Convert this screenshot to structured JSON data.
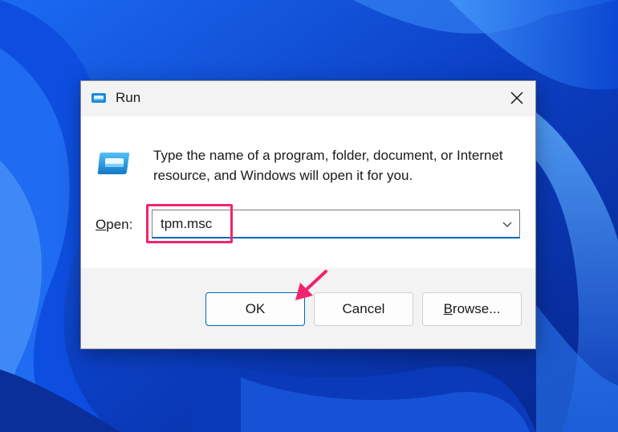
{
  "window": {
    "title": "Run",
    "icon": "run-icon",
    "close_icon": "close-icon"
  },
  "dialog": {
    "description": "Type the name of a program, folder, document, or Internet resource, and Windows will open it for you.",
    "open_label_mnemonic": "O",
    "open_label_rest": "pen:",
    "input_value": "tpm.msc",
    "dropdown_icon": "chevron-down-icon"
  },
  "buttons": {
    "ok": "OK",
    "cancel": "Cancel",
    "browse_mnemonic": "B",
    "browse_rest": "rowse..."
  },
  "annotations": {
    "highlight_color": "#f0246e",
    "arrow_color": "#f0246e"
  },
  "colors": {
    "accent": "#0067c0",
    "titlebar": "#f3f3f3",
    "wallpaper": "#0a47d6"
  }
}
